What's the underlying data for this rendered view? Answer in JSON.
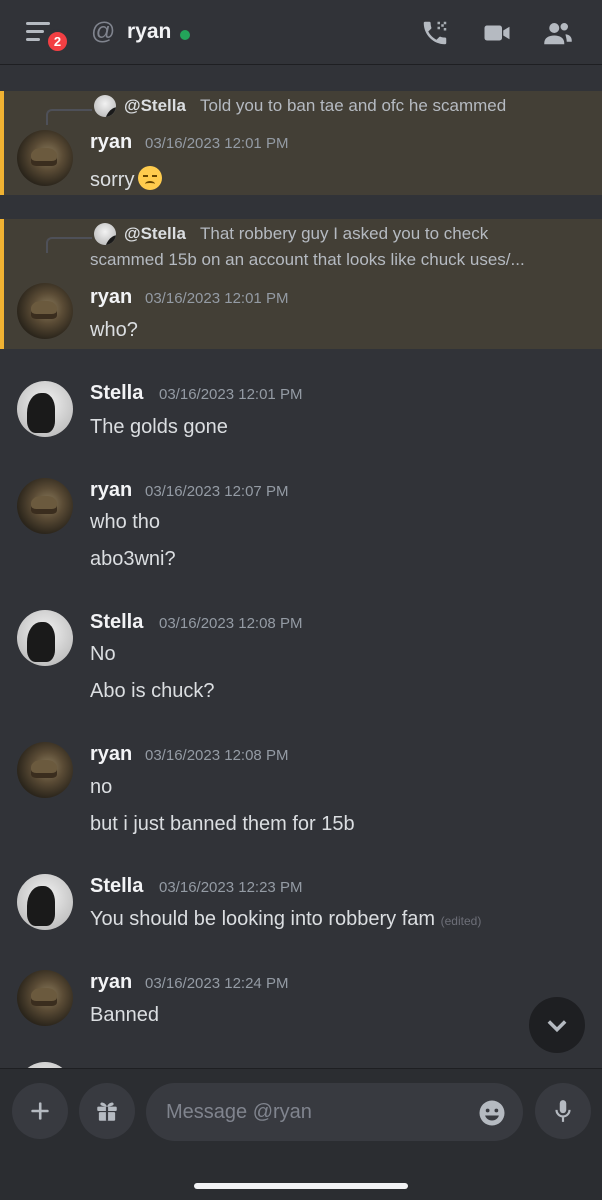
{
  "header": {
    "badge_count": "2",
    "at_symbol": "@",
    "channel_name": "ryan"
  },
  "messages": [
    {
      "reply": {
        "name": "@Stella",
        "text_line1": "Told you to ban tae and ofc he scammed"
      },
      "author": "ryan",
      "timestamp": "03/16/2023 12:01 PM",
      "lines": [
        "sorry"
      ]
    },
    {
      "reply": {
        "name": "@Stella",
        "text_line1": "That robbery guy I asked you to check",
        "text_line2": "scammed 15b on an account that looks like chuck uses/..."
      },
      "author": "ryan",
      "timestamp": "03/16/2023 12:01 PM",
      "lines": [
        "who?"
      ]
    },
    {
      "author": "Stella",
      "timestamp": "03/16/2023 12:01 PM",
      "lines": [
        "The golds gone"
      ]
    },
    {
      "author": "ryan",
      "timestamp": "03/16/2023 12:07 PM",
      "lines": [
        "who tho",
        "abo3wni?"
      ]
    },
    {
      "author": "Stella",
      "timestamp": "03/16/2023 12:08 PM",
      "lines": [
        "No",
        "Abo is chuck?"
      ]
    },
    {
      "author": "ryan",
      "timestamp": "03/16/2023 12:08 PM",
      "lines": [
        "no",
        "but i just banned them for 15b"
      ]
    },
    {
      "author": "Stella",
      "timestamp": "03/16/2023 12:23 PM",
      "lines": [
        "You should be looking into robbery fam"
      ],
      "edited": "(edited)"
    },
    {
      "author": "ryan",
      "timestamp": "03/16/2023 12:24 PM",
      "lines": [
        "Banned"
      ]
    }
  ],
  "composer": {
    "placeholder": "Message @ryan"
  },
  "colors": {
    "background": "#313338",
    "mention_highlight": "#433f36",
    "mention_bar": "#f0b232",
    "online": "#23a55a",
    "badge": "#f23f43"
  },
  "icons": [
    "menu-icon",
    "phone-icon",
    "video-icon",
    "members-icon",
    "chevron-down-icon",
    "plus-icon",
    "gift-icon",
    "emoji-icon",
    "microphone-icon"
  ]
}
